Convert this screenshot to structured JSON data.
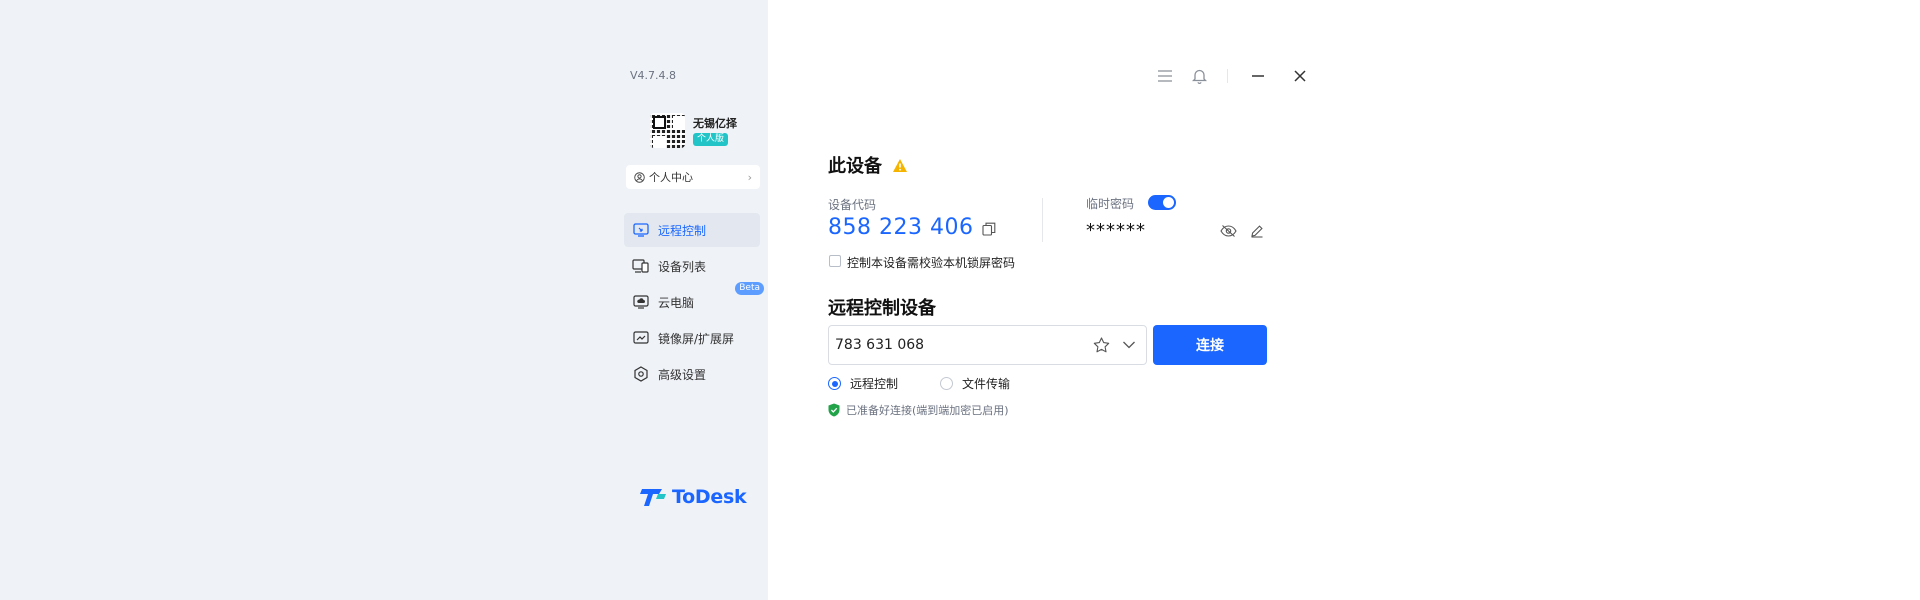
{
  "app": {
    "version": "V4.7.4.8",
    "brand": "ToDesk",
    "colors": {
      "accent": "#1a66ff",
      "sidebar_bg": "#eff2f7",
      "badge": "#23c4c7",
      "beta": "#5c9dff",
      "success": "#22a34a",
      "warning": "#f5b400"
    }
  },
  "profile": {
    "name": "无锡亿择",
    "edition_badge": "个人版",
    "avatar_icon": "qr-code-icon"
  },
  "sidebar": {
    "personal_center": {
      "label": "个人中心",
      "icon": "user-circle-icon"
    },
    "items": [
      {
        "label": "远程控制",
        "icon": "remote-desktop-icon",
        "active": true
      },
      {
        "label": "设备列表",
        "icon": "devices-icon"
      },
      {
        "label": "云电脑",
        "icon": "cloud-pc-icon",
        "badge": "Beta"
      },
      {
        "label": "镜像屏/扩展屏",
        "icon": "mirror-screen-icon"
      },
      {
        "label": "高级设置",
        "icon": "settings-icon"
      }
    ]
  },
  "window_controls": {
    "menu": "menu-icon",
    "notifications": "bell-icon",
    "minimize": "minimize-icon",
    "close": "close-icon"
  },
  "this_device": {
    "title": "此设备",
    "warning_icon": "warning-icon",
    "device_code_label": "设备代码",
    "device_code": "858 223 406",
    "temp_password_label": "临时密码",
    "temp_password_enabled": true,
    "temp_password": "******",
    "lock_screen_checkbox_label": "控制本设备需校验本机锁屏密码",
    "lock_screen_checked": false
  },
  "remote": {
    "title": "远程控制设备",
    "input_value": "783 631 068",
    "connect_label": "连接",
    "modes": [
      {
        "label": "远程控制",
        "checked": true
      },
      {
        "label": "文件传输",
        "checked": false
      }
    ],
    "status_text": "已准备好连接(端到端加密已启用)"
  }
}
